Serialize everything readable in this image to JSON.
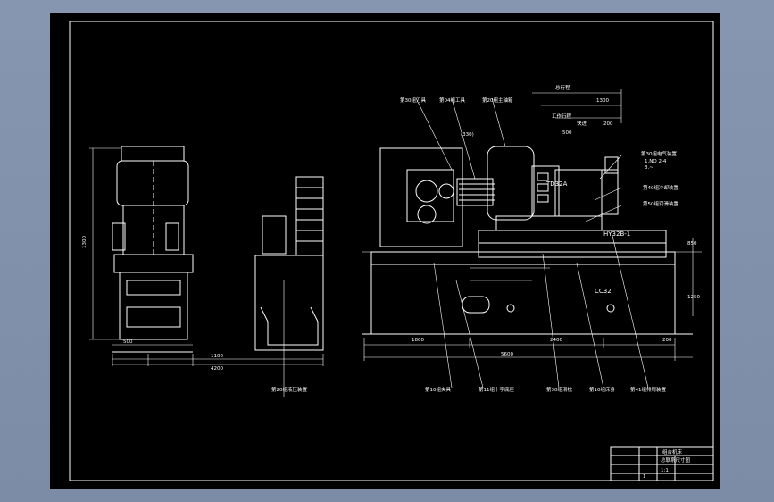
{
  "drawing": {
    "labels": {
      "machine_model": "TD32A",
      "slide_model": "HY32B-1",
      "column_model": "CC32",
      "hydraulic_station_callout": "第20组液压装置",
      "fixture_callout": "第10组夹具",
      "tool_callout": "第04组工具",
      "spindle_callout": "第20组主轴箱",
      "cutter_callout": "第30组刀具",
      "electrical_callout": "第30组电气装置",
      "cooling_callout": "第40组冷却装置",
      "lubrication_callout": "第50组润滑装置",
      "center_base_callout": "第11组十字底座",
      "slide_base_callout": "第30组滑枕",
      "bed_callout": "第10组床身",
      "chip_callout": "第41组排屑装置",
      "spec_line1": "1.NO 2-4",
      "spec_line2": "3.~"
    },
    "dimensions": {
      "left_height": "1300",
      "right_height": "850",
      "right_height2": "1250",
      "left_width1": "500",
      "left_width2": "1100",
      "left_total": "4200",
      "right_total": "5600",
      "right_seg1": "1800",
      "right_seg2": "2400",
      "right_seg3": "200",
      "stroke": "(330)",
      "top_a": "1300",
      "top_b": "500",
      "top_c": "200",
      "work_travel": "工作行程",
      "fast_forward": "快进",
      "total_travel": "总行程"
    },
    "title_block": {
      "name": "组合机床",
      "drawing_no": "总联系尺寸图",
      "scale": "1:1",
      "sheet": "1"
    }
  },
  "colors": {
    "background": "#000000",
    "line": "#ffffff",
    "frame": "#8393ad"
  }
}
